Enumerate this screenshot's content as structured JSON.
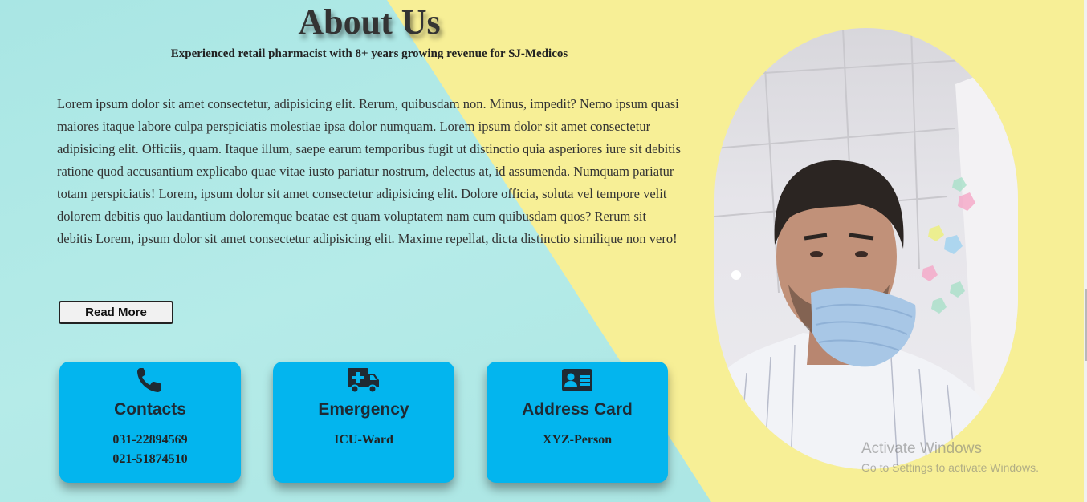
{
  "header": {
    "title": "About Us",
    "subtitle": "Experienced retail pharmacist with 8+ years growing revenue for SJ-Medicos"
  },
  "about": {
    "paragraph": "Lorem ipsum dolor sit amet consectetur, adipisicing elit. Rerum, quibusdam non. Minus, impedit? Nemo ipsum quasi maiores itaque labore culpa perspiciatis molestiae ipsa dolor numquam. Lorem ipsum dolor sit amet consectetur adipisicing elit. Officiis, quam. Itaque illum, saepe earum temporibus fugit ut distinctio quia asperiores iure sit debitis ratione quod accusantium explicabo quae vitae iusto pariatur nostrum, delectus at, id assumenda. Numquam pariatur totam perspiciatis! Lorem, ipsum dolor sit amet consectetur adipisicing elit. Dolore officia, soluta vel tempore velit dolorem debitis quo laudantium doloremque beatae est quam voluptatem nam cum quibusdam quos? Rerum sit debitis Lorem, ipsum dolor sit amet consectetur adipisicing elit. Maxime repellat, dicta distinctio similique non vero!",
    "read_more_label": "Read More"
  },
  "cards": [
    {
      "icon": "phone-icon",
      "title": "Contacts",
      "lines": [
        "031-22894569",
        "021-51874510"
      ]
    },
    {
      "icon": "ambulance-icon",
      "title": "Emergency",
      "lines": [
        "ICU-Ward"
      ]
    },
    {
      "icon": "address-card-icon",
      "title": "Address Card",
      "lines": [
        "XYZ-Person"
      ]
    }
  ],
  "watermark": {
    "line1": "Activate Windows",
    "line2": "Go to Settings to activate Windows."
  },
  "colors": {
    "teal_bg": "#a9e6e4",
    "yellow_bg": "#f7ef96",
    "card_blue": "#03b5ee"
  }
}
